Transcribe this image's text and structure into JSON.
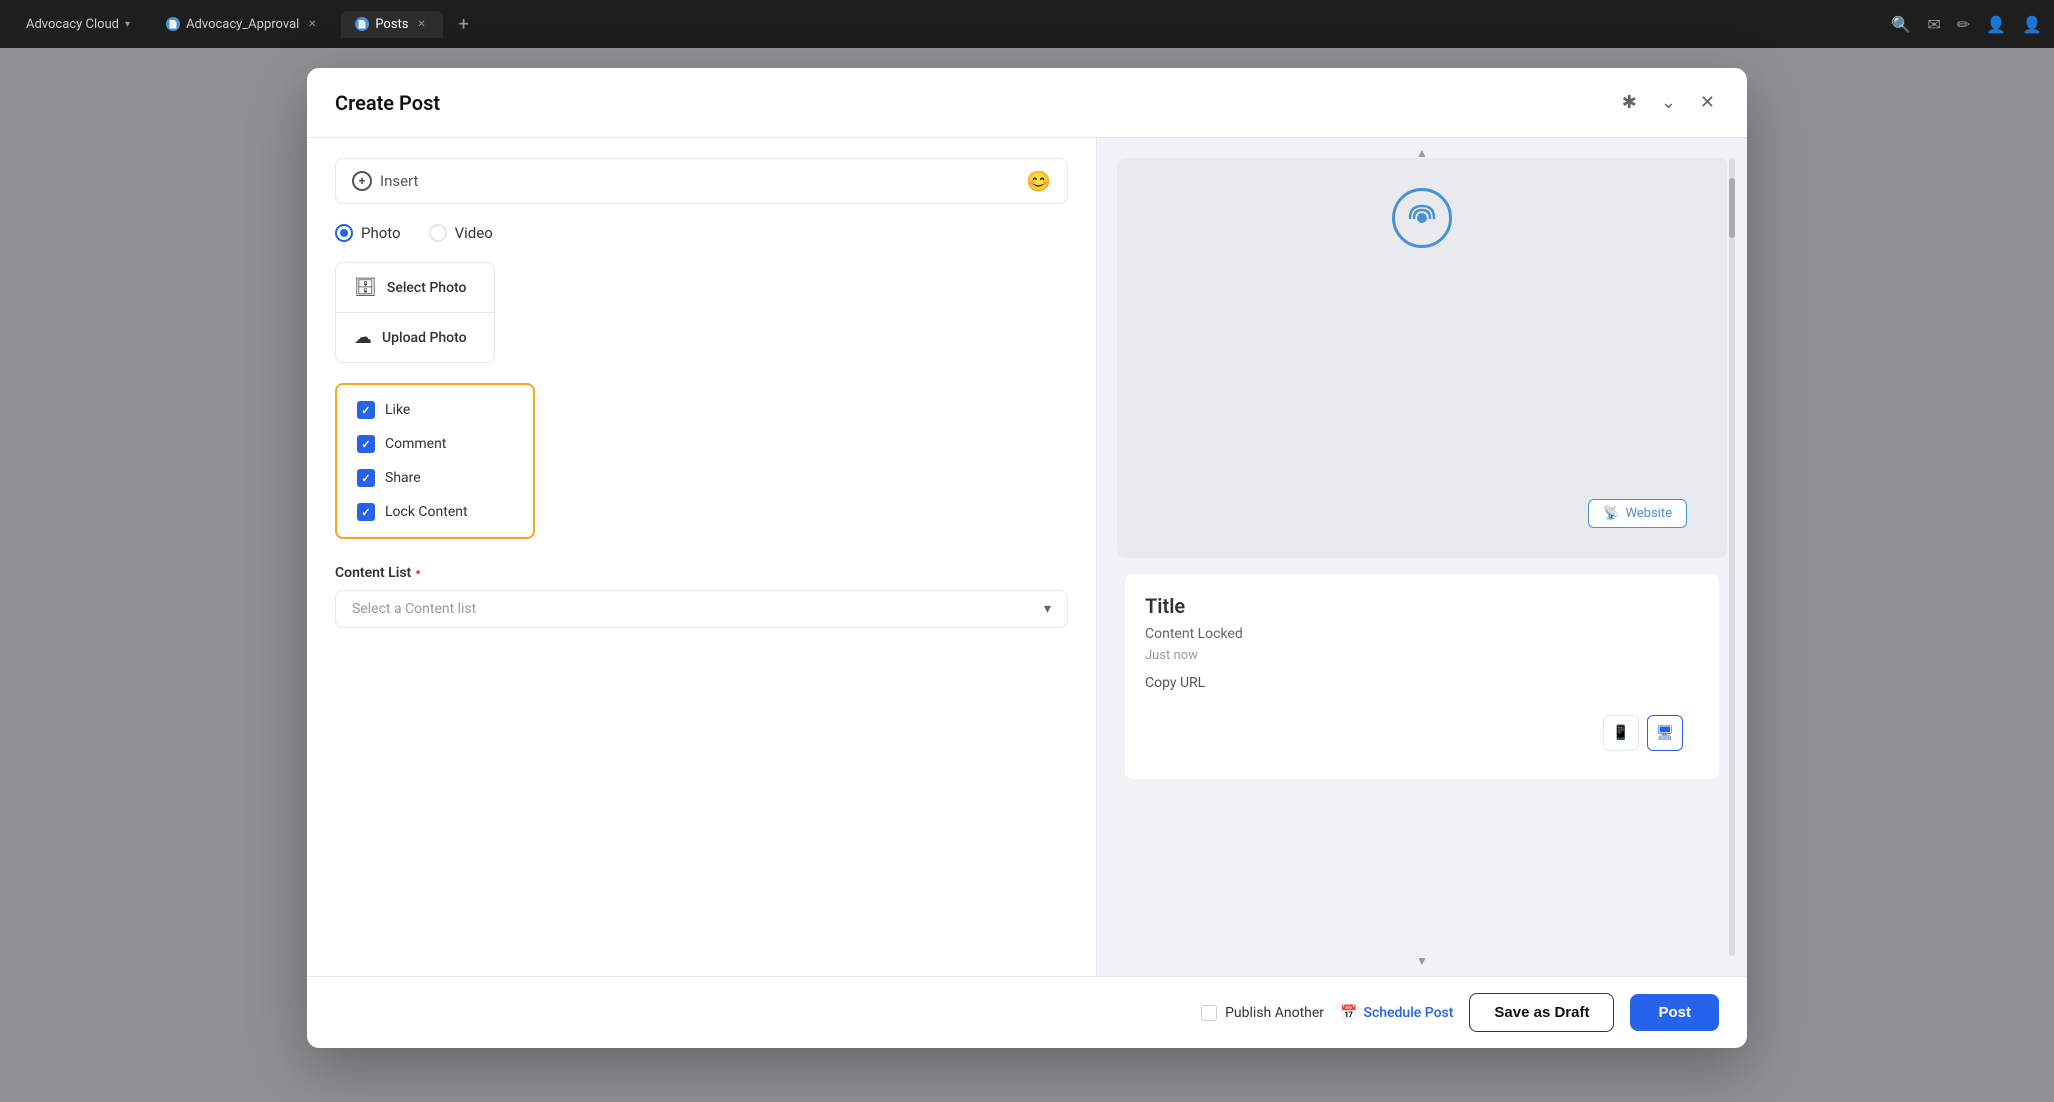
{
  "browser": {
    "tabs": [
      {
        "label": "Advocacy Cloud",
        "icon": "≡",
        "active": false,
        "closable": false
      },
      {
        "label": "Advocacy_Approval",
        "icon": "📄",
        "active": false,
        "closable": true
      },
      {
        "label": "Posts",
        "icon": "📄",
        "active": true,
        "closable": true
      }
    ],
    "add_tab": "+",
    "actions": [
      "🔍",
      "✉",
      "✏",
      "👤",
      "👤"
    ]
  },
  "modal": {
    "title": "Create Post",
    "header_actions": {
      "pin": "✱",
      "chevron": "⌄",
      "close": "✕"
    }
  },
  "left_panel": {
    "insert_bar": {
      "label": "Insert",
      "icon": "+",
      "right_icon": "😊"
    },
    "media_type": {
      "options": [
        "Photo",
        "Video"
      ],
      "selected": "Photo"
    },
    "photo_options": [
      {
        "label": "Select Photo",
        "icon": "🗄"
      },
      {
        "label": "Upload Photo",
        "icon": "☁"
      }
    ],
    "checkboxes": [
      {
        "label": "Like",
        "checked": true
      },
      {
        "label": "Comment",
        "checked": true
      },
      {
        "label": "Share",
        "checked": true
      },
      {
        "label": "Lock Content",
        "checked": true
      }
    ],
    "content_list": {
      "label": "Content List",
      "required": true,
      "placeholder": "Select a Content list"
    }
  },
  "right_panel": {
    "preview": {
      "website_badge": "Website",
      "website_icon": "📡"
    },
    "post_card": {
      "title": "Title",
      "status": "Content Locked",
      "time": "Just now",
      "link": "Copy URL"
    },
    "device_buttons": [
      {
        "icon": "📱",
        "label": "mobile",
        "active": false
      },
      {
        "icon": "🖥",
        "label": "desktop",
        "active": true
      }
    ]
  },
  "footer": {
    "publish_another": "Publish Another",
    "schedule_post": "Schedule Post",
    "save_draft": "Save as Draft",
    "post": "Post"
  }
}
